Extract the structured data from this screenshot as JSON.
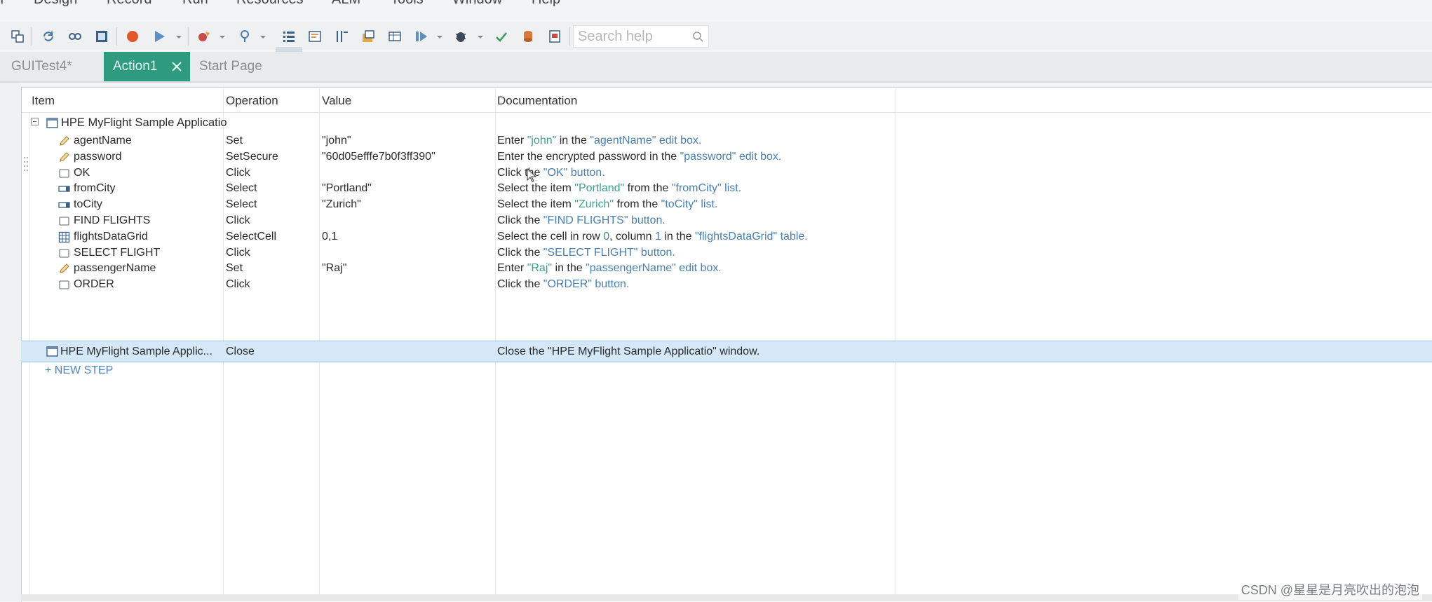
{
  "menu": [
    "Design",
    "Record",
    "Run",
    "Resources",
    "ALM",
    "Tools",
    "Window",
    "Help"
  ],
  "search": {
    "placeholder": "Search help"
  },
  "tabs": [
    {
      "label": "GUITest4*",
      "active": false
    },
    {
      "label": "Action1",
      "active": true
    },
    {
      "label": "Start Page",
      "active": false
    }
  ],
  "columns": {
    "item": "Item",
    "operation": "Operation",
    "value": "Value",
    "documentation": "Documentation"
  },
  "parent": {
    "label": "HPE MyFlight Sample Applicatio"
  },
  "steps": [
    {
      "item": "agentName",
      "icon": "edit-icon",
      "operation": "Set",
      "value": "\"john\"",
      "doc": [
        [
          "Enter ",
          ""
        ],
        [
          "\"john\"",
          "hn"
        ],
        [
          " in the ",
          ""
        ],
        [
          "\"agentName\"",
          "hl"
        ],
        [
          " edit box.",
          "hl"
        ]
      ]
    },
    {
      "item": "password",
      "icon": "edit-icon",
      "operation": "SetSecure",
      "value": "\"60d05efffe7b0f3ff390\"",
      "doc": [
        [
          "Enter the encrypted password in the ",
          ""
        ],
        [
          "\"password\"",
          "hl"
        ],
        [
          " edit box.",
          "hl"
        ]
      ]
    },
    {
      "item": "OK",
      "icon": "button-icon",
      "operation": "Click",
      "value": "",
      "doc": [
        [
          "Click the ",
          ""
        ],
        [
          "\"OK\" button.",
          "hl"
        ]
      ]
    },
    {
      "item": "fromCity",
      "icon": "list-icon",
      "operation": "Select",
      "value": "\"Portland\"",
      "doc": [
        [
          "Select the item ",
          ""
        ],
        [
          "\"Portland\"",
          "hn"
        ],
        [
          " from the ",
          ""
        ],
        [
          "\"fromCity\" list.",
          "hl"
        ]
      ]
    },
    {
      "item": "toCity",
      "icon": "list-icon",
      "operation": "Select",
      "value": "\"Zurich\"",
      "doc": [
        [
          "Select the item ",
          ""
        ],
        [
          "\"Zurich\"",
          "hn"
        ],
        [
          " from the ",
          ""
        ],
        [
          "\"toCity\" list.",
          "hl"
        ]
      ]
    },
    {
      "item": "FIND FLIGHTS",
      "icon": "button-icon",
      "operation": "Click",
      "value": "",
      "doc": [
        [
          "Click the ",
          ""
        ],
        [
          "\"FIND FLIGHTS\" button.",
          "hl"
        ]
      ]
    },
    {
      "item": "flightsDataGrid",
      "icon": "grid-icon",
      "operation": "SelectCell",
      "value": "0,1",
      "doc": [
        [
          "Select the cell in row ",
          ""
        ],
        [
          "0",
          "hl"
        ],
        [
          ", column ",
          ""
        ],
        [
          "1",
          "hl"
        ],
        [
          " in the ",
          ""
        ],
        [
          "\"flightsDataGrid\" table.",
          "hl"
        ]
      ]
    },
    {
      "item": "SELECT FLIGHT",
      "icon": "button-icon",
      "operation": "Click",
      "value": "",
      "doc": [
        [
          "Click the ",
          ""
        ],
        [
          "\"SELECT FLIGHT\" button.",
          "hl"
        ]
      ]
    },
    {
      "item": "passengerName",
      "icon": "edit-icon",
      "operation": "Set",
      "value": "\"Raj\"",
      "doc": [
        [
          "Enter ",
          ""
        ],
        [
          "\"Raj\"",
          "hn"
        ],
        [
          " in the ",
          ""
        ],
        [
          "\"passengerName\" edit box.",
          "hl"
        ]
      ]
    },
    {
      "item": "ORDER",
      "icon": "button-icon",
      "operation": "Click",
      "value": "",
      "doc": [
        [
          "Click the ",
          ""
        ],
        [
          "\"ORDER\" button.",
          "hl"
        ]
      ]
    }
  ],
  "close_step": {
    "item": "HPE MyFlight Sample Applic...",
    "operation": "Close",
    "value": "",
    "doc": "Close the \"HPE MyFlight Sample Applicatio\" window."
  },
  "new_step": "+ NEW STEP",
  "watermark": "CSDN @星星是月亮吹出的泡泡",
  "colors": {
    "active_tab": "#2f9b7e",
    "selected_row": "#d5e8f7",
    "link_blue": "#4a7fb1",
    "value_green": "#3fa08a"
  }
}
